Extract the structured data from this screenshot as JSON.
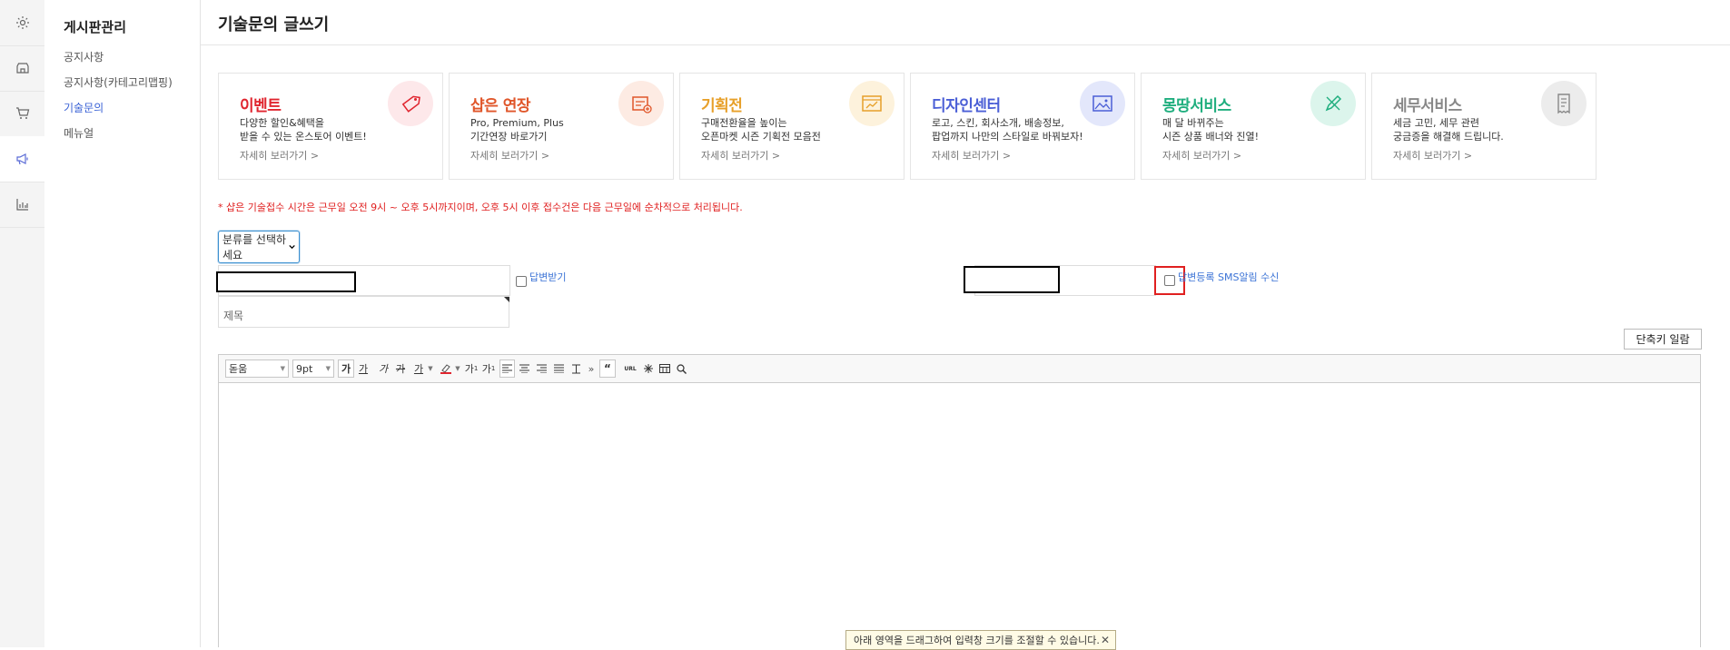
{
  "sidebar": {
    "title": "게시판관리",
    "items": [
      {
        "label": "공지사항"
      },
      {
        "label": "공지사항(카테고리맵핑)"
      },
      {
        "label": "기술문의"
      },
      {
        "label": "메뉴얼"
      }
    ]
  },
  "page": {
    "title": "기술문의 글쓰기"
  },
  "cards": [
    {
      "title": "이벤트",
      "color": "#e0252f",
      "line1": "다양한 할인&혜택을",
      "line2": "받을 수 있는 온스토어 이벤트!",
      "more": "자세히 보러가기 >"
    },
    {
      "title": "샵은 연장",
      "color": "#e0562a",
      "line1": "Pro, Premium, Plus",
      "line2": "기간연장 바로가기",
      "more": "자세히 보러가기 >"
    },
    {
      "title": "기획전",
      "color": "#e7a02a",
      "line1": "구매전환율을 높이는",
      "line2": "오픈마켓 시즌 기획전 모음전",
      "more": "자세히 보러가기 >"
    },
    {
      "title": "디자인센터",
      "color": "#4b5fd6",
      "line1": "로고, 스킨, 회사소개, 배송정보,",
      "line2": "팝업까지 나만의 스타일로 바꿔보자!",
      "more": "자세히 보러가기 >"
    },
    {
      "title": "몽땅서비스",
      "color": "#1fae7e",
      "line1": "매 달 바뀌주는",
      "line2": "시즌 상품 배너와 진열!",
      "more": "자세히 보러가기 >"
    },
    {
      "title": "세무서비스",
      "color": "#888888",
      "line1": "세금 고민, 세무 관련",
      "line2": "궁금증을 해결해 드립니다.",
      "more": "자세히 보러가기 >"
    }
  ],
  "notice": "* 샵은 기술접수 시간은 근무일 오전 9시 ~ 오후 5시까지이며, 오후 5시 이후 접수건은 다음 근무일에 순차적으로 처리됩니다.",
  "form": {
    "category_select": "분류를 선택하세요",
    "reply_label": "답변받기",
    "sms_label": "답변등록 SMS알림 수신",
    "subject_placeholder": "제목",
    "shortcut_button": "단축키 일람"
  },
  "toolbar": {
    "font": "돋움",
    "size": "9pt",
    "bold": "가",
    "underline": "가",
    "italic": "가",
    "strike": "가",
    "fontcolor": "가",
    "sup": "가",
    "sub": "가",
    "url": "URL"
  },
  "editor": {
    "resize_tip": "아래 영역을 드래그하여 입력창 크기를 조절할 수 있습니다."
  }
}
